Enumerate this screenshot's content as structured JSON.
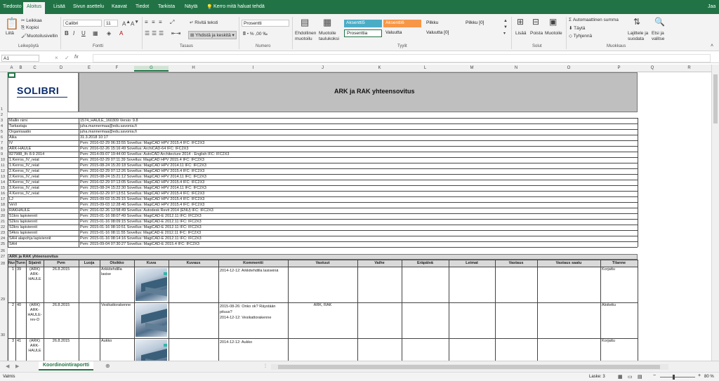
{
  "tabs": [
    "Tiedosto",
    "Aloitus",
    "Lisää",
    "Sivun asettelu",
    "Kaavat",
    "Tiedot",
    "Tarkista",
    "Näytä"
  ],
  "tell_me": "Kerro mitä haluat tehdä",
  "user": "Jaa",
  "ribbon": {
    "paste": "Liitä",
    "cut": "Leikkaa",
    "copy": "Kopioi",
    "format_painter": "Muotoilusivellin",
    "clipboard_group": "Leikepöytä",
    "font_name": "Calibri",
    "font_size": "11",
    "font_group": "Fontti",
    "wrap_text": "Rivitä teksti",
    "merge_center": "Yhdistä ja keskitä",
    "alignment_group": "Tasaus",
    "number_format": "Prosentti",
    "number_group": "Numero",
    "cond_format": "Ehdollinen muotoilu",
    "format_table": "Muotoile taulukoksi",
    "styles": [
      "Aksentti5",
      "Aksentti6",
      "Pilkku",
      "Pilkku [0]",
      "Prosenttia",
      "Valuutta",
      "Valuutta [0]"
    ],
    "styles_group": "Tyylit",
    "insert": "Lisää",
    "delete": "Poista",
    "format": "Muotoile",
    "cells_group": "Solut",
    "autosum": "Automaattinen summa",
    "fill": "Täytä",
    "clear": "Tyhjennä",
    "sort_filter": "Lajittele ja suodata",
    "find_select": "Etsi ja valitse",
    "editing_group": "Muokkaus"
  },
  "formula_bar": {
    "name_box": "A1",
    "cancel": "×",
    "enter": "✓",
    "fx": "fx",
    "content": ""
  },
  "columns": [
    "A",
    "B",
    "C",
    "D",
    "E",
    "F",
    "G",
    "H",
    "I",
    "J",
    "K",
    "L",
    "M",
    "N",
    "O",
    "P",
    "Q",
    "R"
  ],
  "rows": [
    "1",
    "2",
    "3",
    "4",
    "5",
    "6",
    "7",
    "8",
    "9",
    "10",
    "11",
    "12",
    "13",
    "14",
    "15",
    "16",
    "17",
    "18",
    "19",
    "20",
    "21",
    "22",
    "23",
    "24",
    "25",
    "26",
    "27",
    "28",
    "29",
    "30",
    "31"
  ],
  "logo": {
    "text": "SOLIBRI"
  },
  "title": "ARK ja RAK yhteensovitus",
  "info": [
    {
      "label": "Mallin nimi",
      "value": "1574_HAULE_160309 Versio: 9.8"
    },
    {
      "label": "Tarkastaja",
      "value": "juha.mannermaa@edu.savonia.fi"
    },
    {
      "label": "Organisaatio",
      "value": "juha.mannermaa@edu.savonia.fi"
    },
    {
      "label": "Aika",
      "value": "31.3.2018 10:17"
    },
    {
      "label": "IV",
      "value": "Pvm: 2016-02-29 06:33:55 Sovellus: MagiCAD HPV 2015.4 IFC: IFC2X3"
    },
    {
      "label": "ARK-HAULE",
      "value": "Pvm: 2016-02-26 15:16:49 Sovellus: ArchiCAD-64 IFC: IFC2X3"
    },
    {
      "label": "827988_Ifc 8.9 2014",
      "value": "Pvm: 2014-09-07 19:44:00 Sovellus: AutoCAD Architecture 2014 - English IFC: IFC2X3"
    },
    {
      "label": "1.Kerros_IV_reiat",
      "value": "Pvm: 2016-02-29 07:11:39 Sovellus: MagiCAD HPV 2015.4 IFC: IFC2X3"
    },
    {
      "label": "1.Kerros_IV_reiat",
      "value": "Pvm: 2015-08-24 15:20:18 Sovellus: MagiCAD HPV 2014.11 IFC: IFC2X3"
    },
    {
      "label": "2.Kerros_IV_reiat",
      "value": "Pvm: 2016-02-29 07:12:26 Sovellus: MagiCAD HPV 2015.4 IFC: IFC2X3"
    },
    {
      "label": "2.Kerros_IV_reiat",
      "value": "Pvm: 2015-08-24 15:21:12 Sovellus: MagiCAD HPV 2014.11 IFC: IFC2X3"
    },
    {
      "label": "3.Kerros_IV_reiat",
      "value": "Pvm: 2016-02-29 07:13:05 Sovellus: MagiCAD HPV 2015.4 IFC: IFC2X3"
    },
    {
      "label": "3.Kerros_IV_reiat",
      "value": "Pvm: 2015-08-24 15:22:30 Sovellus: MagiCAD HPV 2014.11 IFC: IFC2X3"
    },
    {
      "label": "4.Kerros_IV_reiat",
      "value": "Pvm: 2016-02-29 07:13:51 Sovellus: MagiCAD HPV 2015.4 IFC: IFC2X3"
    },
    {
      "label": "LJ",
      "value": "Pvm: 2015-09-03 15:25:15 Sovellus: MagiCAD HPV 2015.4 IFC: IFC2X3"
    },
    {
      "label": "VeVi",
      "value": "Pvm: 2015-09-03 12:28:46 Sovellus: MagiCAD HPV 2015.4 IFC: IFC2X3"
    },
    {
      "label": "RAKHAULE",
      "value": "Pvm: 2016-02-26 13:58:49 Sovellus: Autodesk Revit 2014 (ENU) IFC: IFC2X3"
    },
    {
      "label": "S1krs lapiviennit",
      "value": "Pvm: 2015-01-16 08:07:49 Sovellus: MagiCAD-E 2012.11 IFC: IFC2X3"
    },
    {
      "label": "S2krs lapiviennit",
      "value": "Pvm: 2015-01-16 08:09:15 Sovellus: MagiCAD-E 2012.11 IFC: IFC2X3"
    },
    {
      "label": "S3krs lapiviennit",
      "value": "Pvm: 2015-01-16 08:10:51 Sovellus: MagiCAD-E 2012.11 IFC: IFC2X3"
    },
    {
      "label": "S4krs lapiviennit",
      "value": "Pvm: 2015-01-16 08:11:55 Sovellus: MagiCAD-E 2012.11 IFC: IFC2X3"
    },
    {
      "label": "SAH alapohja lapiviennit",
      "value": "Pvm: 2015-01-16 08:14:16 Sovellus: MagiCAD-E 2012.11 IFC: IFC2X3"
    },
    {
      "label": "SAH",
      "value": "Pvm: 2015-09-04 07:30:27 Sovellus: MagiCAD-E 2015.4 IFC: IFC2X3"
    }
  ],
  "section_title": "ARK ja RAK yhteensovitus",
  "table_headers": [
    "Numero",
    "Tunnus",
    "Sijainti",
    "Pvm",
    "Luoja",
    "Otsikko",
    "Kuva",
    "Kuvaus",
    "Kommentti",
    "Vastuut",
    "Vaihe",
    "Eräpäivä",
    "Leimat",
    "Vastaus",
    "Vastaus saatu",
    "Tilanne"
  ],
  "issues": [
    {
      "num": "1",
      "id": "39",
      "loc": "(ARK) ARK-HAULE",
      "date": "26.8.2015",
      "author": "",
      "title": "Arkkitehdilla lasise",
      "desc": "",
      "comment": "2014-12-12: Arkkitehdilla lasiseinä",
      "resp": "",
      "status": "Korjattu"
    },
    {
      "num": "2",
      "id": "40",
      "loc": "(ARK) ARK-HAULE-rev-D",
      "date": "26.8.2015",
      "author": "",
      "title": "Vesikattorakenne",
      "desc": "",
      "comment": "2015-08-26: Onko ok? Räystään pituus?\n2014-12-12: Vesikattorakenne",
      "resp": "ARK, RAK",
      "status": "Aloitettu"
    },
    {
      "num": "3",
      "id": "41",
      "loc": "(ARK) ARK-HAULE",
      "date": "26.8.2015",
      "author": "",
      "title": "Aukko",
      "desc": "",
      "comment": "2014-12-12: Aukko",
      "resp": "",
      "status": "Korjattu"
    }
  ],
  "sheet_tab": "Koordinointiraportti",
  "status": {
    "ready": "Valmis",
    "count": "Laske: 3",
    "zoom": "80 %"
  }
}
